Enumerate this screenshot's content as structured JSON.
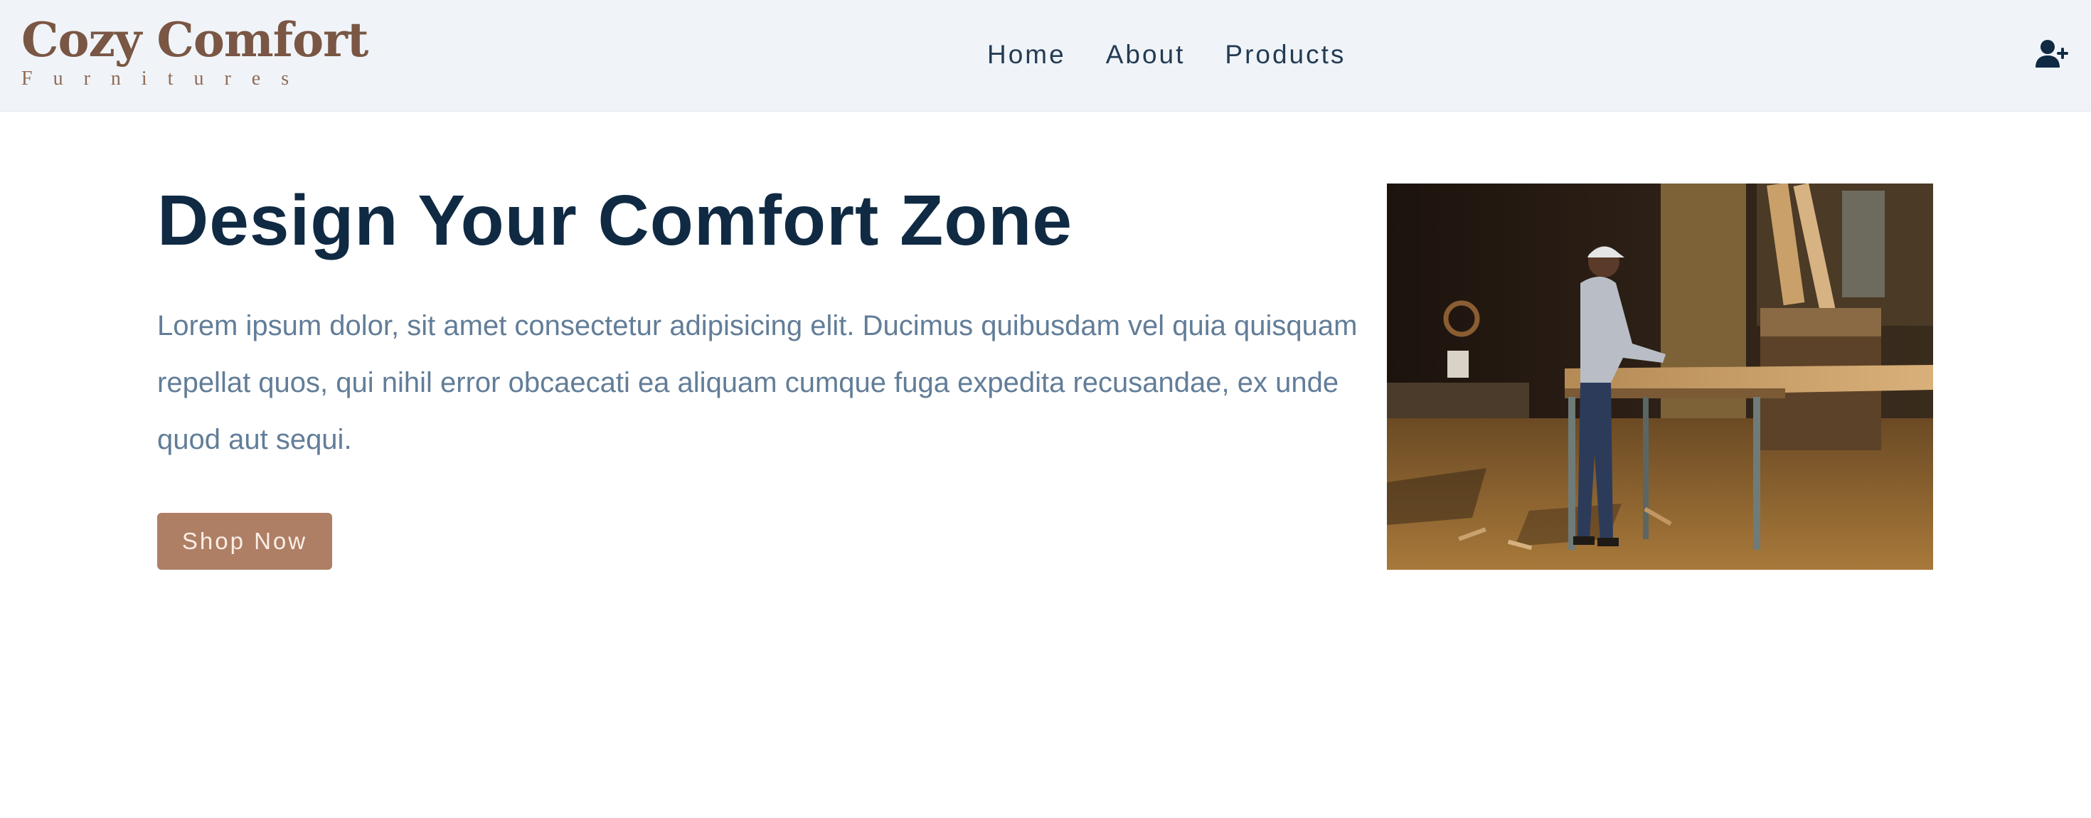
{
  "brand": {
    "name": "Cozy Comfort",
    "tagline": "Furnitures"
  },
  "nav": {
    "links": [
      "Home",
      "About",
      "Products"
    ]
  },
  "icons": {
    "user_action": "user-plus-icon"
  },
  "hero": {
    "title": "Design Your Comfort Zone",
    "text": "Lorem ipsum dolor, sit amet consectetur adipisicing elit. Ducimus quibusdam vel quia quisquam repellat quos, qui nihil error obcaecati ea aliquam cumque fuga expedita recusandae, ex unde quod aut sequi.",
    "button_label": "Shop Now",
    "image_subject": "craftsman-working-on-table-photo"
  },
  "colors": {
    "nav_bg": "#f0f4f8",
    "brand": "#7a5644",
    "title": "#102a43",
    "body_text": "#627d98",
    "button_bg": "#ae7f65"
  }
}
